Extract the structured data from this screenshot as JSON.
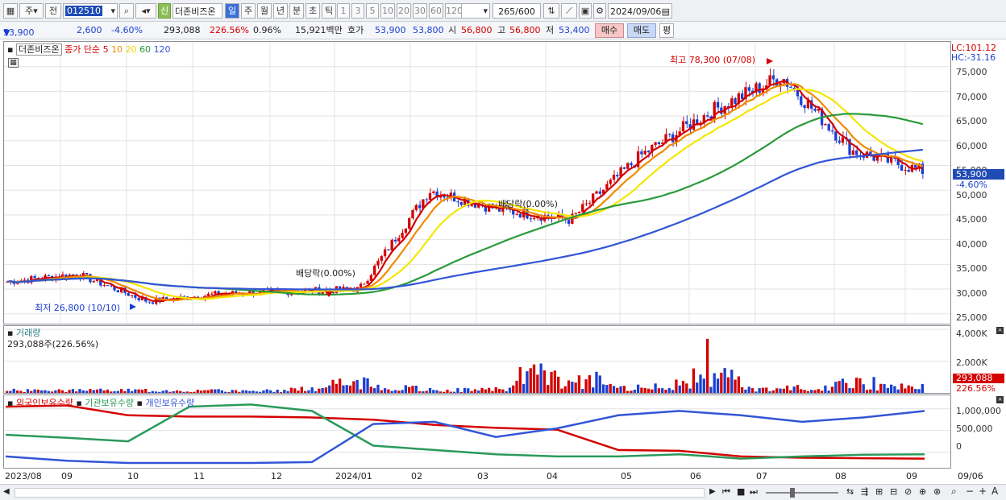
{
  "toolbar": {
    "code": "012510",
    "btn_ju": "주",
    "btn_jeon": "전",
    "btn_sin": "신",
    "stock_name": "더존비즈온",
    "periods": [
      "일",
      "주",
      "월",
      "년",
      "분",
      "초",
      "틱"
    ],
    "intervals": [
      "1",
      "3",
      "5",
      "10",
      "20",
      "30",
      "60",
      "120"
    ],
    "count": "265",
    "count_total": "/600",
    "date": "2024/09/06"
  },
  "quote": {
    "price": "53,900",
    "arrow": "▼",
    "change": "2,600",
    "change_pct": "-4.60%",
    "volume": "293,088",
    "volume_pct": "226.56%",
    "turnover": "0.96%",
    "amount": "15,921백만",
    "ask_label": "호가",
    "ask": "53,900",
    "bid": "53,800",
    "open_label": "시",
    "open": "56,800",
    "high_label": "고",
    "high": "56,800",
    "low_label": "저",
    "low": "53,400",
    "buy_label": "매수",
    "sell_label": "매도",
    "avg_label": "평"
  },
  "legend": {
    "name": "더존비즈온",
    "ma_label": "종가 단순",
    "ma": [
      "5",
      "10",
      "20",
      "60",
      "120"
    ]
  },
  "colors": {
    "up": "#d40000",
    "down": "#1a3fd1",
    "ma5": "#d40000",
    "ma10": "#f08a00",
    "ma20": "#f4e600",
    "ma60": "#2a9a3a",
    "ma120": "#3255d6"
  },
  "price_axis": {
    "lc": "LC:101.12",
    "hc": "HC:-31.16",
    "ticks": [
      "75,000",
      "70,000",
      "65,000",
      "60,000",
      "55,000",
      "50,000",
      "45,000",
      "40,000",
      "35,000",
      "30,000",
      "25,000"
    ],
    "current": "53,900",
    "current_pct": "-4.60%"
  },
  "annotations": {
    "high": "최고 78,300 (07/08)",
    "low": "최저 26,800 (10/10)",
    "div1": "배당락(0.00%)",
    "div2": "배당락(0.00%)"
  },
  "volume_panel": {
    "title": "거래량",
    "value": "293,088주(226.56%)",
    "ticks": [
      "4,000K",
      "2,000K"
    ],
    "current": "293,088",
    "current_pct": "226.56%"
  },
  "holding_panel": {
    "items": [
      "외국인보유수량",
      "기관보유수량",
      "개인보유수량"
    ],
    "ticks": [
      "1,000,000",
      "500,000",
      "0"
    ]
  },
  "x_axis": {
    "labels": [
      "2023/08",
      "09",
      "10",
      "11",
      "12",
      "2024/01",
      "02",
      "03",
      "04",
      "05",
      "06",
      "07",
      "08",
      "09"
    ],
    "right": "09/06"
  },
  "chart_data": [
    {
      "type": "candlestick",
      "title": "더존비즈온",
      "ylim": [
        25000,
        78300
      ],
      "series": [
        {
          "name": "종가",
          "x": [
            "2023/08",
            "2023/09",
            "2023/10",
            "2023/11",
            "2023/12",
            "2024/01",
            "2024/02",
            "2024/03",
            "2024/04",
            "2024/05",
            "2024/06",
            "2024/07",
            "2024/08",
            "2024/09"
          ],
          "values": [
            31500,
            33000,
            27500,
            29000,
            29500,
            30000,
            50000,
            46000,
            44000,
            57000,
            66000,
            73000,
            58000,
            53900
          ]
        }
      ],
      "annotations": [
        "최고 78,300 (07/08)",
        "최저 26,800 (10/10)"
      ]
    },
    {
      "type": "bar",
      "title": "거래량",
      "ylim": [
        0,
        4000000
      ],
      "series": [
        {
          "name": "거래량",
          "values": [
            150000,
            120000,
            180000,
            130000,
            90000,
            110000,
            500000,
            1900000,
            750000,
            300000,
            400000,
            4000000,
            2800000,
            900000,
            1500000,
            3400000,
            600000,
            700000,
            2000000,
            900000,
            293088
          ]
        }
      ]
    },
    {
      "type": "line",
      "ylim": [
        -200000,
        1200000
      ],
      "series": [
        {
          "name": "외국인보유수량",
          "values": [
            1050000,
            1080000,
            850000,
            820000,
            820000,
            800000,
            750000,
            630000,
            560000,
            520000,
            50000,
            30000,
            -100000,
            -130000,
            -140000,
            -150000
          ]
        },
        {
          "name": "기관보유수량",
          "values": [
            400000,
            330000,
            250000,
            1050000,
            1100000,
            950000,
            150000,
            50000,
            -50000,
            -100000,
            -100000,
            -50000,
            -150000,
            -100000,
            -60000,
            -50000
          ]
        },
        {
          "name": "개인보유수량",
          "values": [
            -100000,
            -200000,
            -250000,
            -250000,
            -250000,
            -230000,
            650000,
            700000,
            350000,
            550000,
            850000,
            950000,
            850000,
            700000,
            800000,
            950000
          ]
        }
      ]
    }
  ]
}
